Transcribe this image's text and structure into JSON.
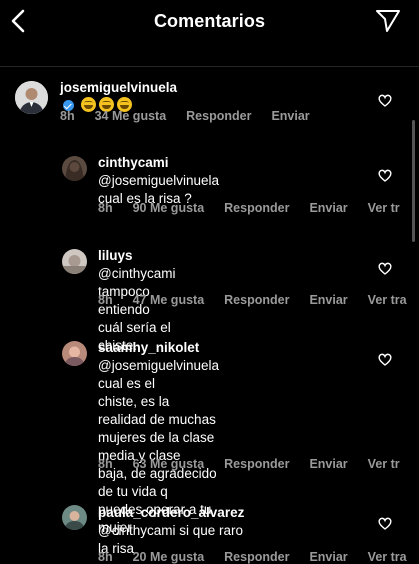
{
  "header": {
    "title": "Comentarios"
  },
  "comments": [
    {
      "user": "josemiguelvinuela",
      "verified": true,
      "text": "😂😂😂",
      "time": "8h",
      "likes": "34 Me gusta",
      "reply": "Responder",
      "send": "Enviar"
    },
    {
      "user": "cinthycami",
      "text_lines": [
        "@josemiguelvinuela",
        "cual es la risa ?"
      ],
      "time": "8h",
      "likes": "90 Me gusta",
      "reply": "Responder",
      "send": "Enviar",
      "more": "Ver tr"
    },
    {
      "user": "liluys",
      "text_lines": [
        "@cinthycami tampoco",
        "entiendo cuál sería el chiste."
      ],
      "time": "8h",
      "likes": "47 Me gusta",
      "reply": "Responder",
      "send": "Enviar",
      "more": "Ver tra"
    },
    {
      "user": "saamhy_nikolet",
      "text_lines": [
        "@josemiguelvinuela cual es el",
        "chiste, es la realidad de muchas",
        "mujeres de la clase media y clase",
        "baja, de agradecido de tu vida q",
        "puedes operar a tu mujer"
      ],
      "time": "8h",
      "likes": "63 Me gusta",
      "reply": "Responder",
      "send": "Enviar",
      "more": "Ver tr"
    },
    {
      "user": "paula_cordero_alvarez",
      "text_lines": [
        "@cinthycami si que raro la risa"
      ],
      "time": "8h",
      "likes": "20 Me gusta",
      "reply": "Responder",
      "send": "Enviar",
      "more": "Ver tra"
    }
  ]
}
